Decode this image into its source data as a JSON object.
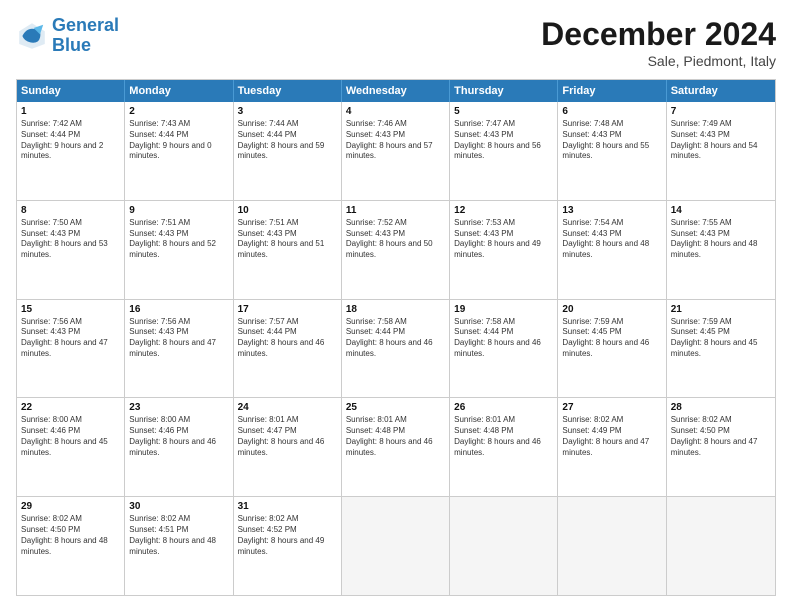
{
  "header": {
    "logo_line1": "General",
    "logo_line2": "Blue",
    "month_title": "December 2024",
    "subtitle": "Sale, Piedmont, Italy"
  },
  "days_of_week": [
    "Sunday",
    "Monday",
    "Tuesday",
    "Wednesday",
    "Thursday",
    "Friday",
    "Saturday"
  ],
  "weeks": [
    [
      {
        "day": "1",
        "sunrise": "7:42 AM",
        "sunset": "4:44 PM",
        "daylight": "9 hours and 2 minutes."
      },
      {
        "day": "2",
        "sunrise": "7:43 AM",
        "sunset": "4:44 PM",
        "daylight": "9 hours and 0 minutes."
      },
      {
        "day": "3",
        "sunrise": "7:44 AM",
        "sunset": "4:44 PM",
        "daylight": "8 hours and 59 minutes."
      },
      {
        "day": "4",
        "sunrise": "7:46 AM",
        "sunset": "4:43 PM",
        "daylight": "8 hours and 57 minutes."
      },
      {
        "day": "5",
        "sunrise": "7:47 AM",
        "sunset": "4:43 PM",
        "daylight": "8 hours and 56 minutes."
      },
      {
        "day": "6",
        "sunrise": "7:48 AM",
        "sunset": "4:43 PM",
        "daylight": "8 hours and 55 minutes."
      },
      {
        "day": "7",
        "sunrise": "7:49 AM",
        "sunset": "4:43 PM",
        "daylight": "8 hours and 54 minutes."
      }
    ],
    [
      {
        "day": "8",
        "sunrise": "7:50 AM",
        "sunset": "4:43 PM",
        "daylight": "8 hours and 53 minutes."
      },
      {
        "day": "9",
        "sunrise": "7:51 AM",
        "sunset": "4:43 PM",
        "daylight": "8 hours and 52 minutes."
      },
      {
        "day": "10",
        "sunrise": "7:51 AM",
        "sunset": "4:43 PM",
        "daylight": "8 hours and 51 minutes."
      },
      {
        "day": "11",
        "sunrise": "7:52 AM",
        "sunset": "4:43 PM",
        "daylight": "8 hours and 50 minutes."
      },
      {
        "day": "12",
        "sunrise": "7:53 AM",
        "sunset": "4:43 PM",
        "daylight": "8 hours and 49 minutes."
      },
      {
        "day": "13",
        "sunrise": "7:54 AM",
        "sunset": "4:43 PM",
        "daylight": "8 hours and 48 minutes."
      },
      {
        "day": "14",
        "sunrise": "7:55 AM",
        "sunset": "4:43 PM",
        "daylight": "8 hours and 48 minutes."
      }
    ],
    [
      {
        "day": "15",
        "sunrise": "7:56 AM",
        "sunset": "4:43 PM",
        "daylight": "8 hours and 47 minutes."
      },
      {
        "day": "16",
        "sunrise": "7:56 AM",
        "sunset": "4:43 PM",
        "daylight": "8 hours and 47 minutes."
      },
      {
        "day": "17",
        "sunrise": "7:57 AM",
        "sunset": "4:44 PM",
        "daylight": "8 hours and 46 minutes."
      },
      {
        "day": "18",
        "sunrise": "7:58 AM",
        "sunset": "4:44 PM",
        "daylight": "8 hours and 46 minutes."
      },
      {
        "day": "19",
        "sunrise": "7:58 AM",
        "sunset": "4:44 PM",
        "daylight": "8 hours and 46 minutes."
      },
      {
        "day": "20",
        "sunrise": "7:59 AM",
        "sunset": "4:45 PM",
        "daylight": "8 hours and 46 minutes."
      },
      {
        "day": "21",
        "sunrise": "7:59 AM",
        "sunset": "4:45 PM",
        "daylight": "8 hours and 45 minutes."
      }
    ],
    [
      {
        "day": "22",
        "sunrise": "8:00 AM",
        "sunset": "4:46 PM",
        "daylight": "8 hours and 45 minutes."
      },
      {
        "day": "23",
        "sunrise": "8:00 AM",
        "sunset": "4:46 PM",
        "daylight": "8 hours and 46 minutes."
      },
      {
        "day": "24",
        "sunrise": "8:01 AM",
        "sunset": "4:47 PM",
        "daylight": "8 hours and 46 minutes."
      },
      {
        "day": "25",
        "sunrise": "8:01 AM",
        "sunset": "4:48 PM",
        "daylight": "8 hours and 46 minutes."
      },
      {
        "day": "26",
        "sunrise": "8:01 AM",
        "sunset": "4:48 PM",
        "daylight": "8 hours and 46 minutes."
      },
      {
        "day": "27",
        "sunrise": "8:02 AM",
        "sunset": "4:49 PM",
        "daylight": "8 hours and 47 minutes."
      },
      {
        "day": "28",
        "sunrise": "8:02 AM",
        "sunset": "4:50 PM",
        "daylight": "8 hours and 47 minutes."
      }
    ],
    [
      {
        "day": "29",
        "sunrise": "8:02 AM",
        "sunset": "4:50 PM",
        "daylight": "8 hours and 48 minutes."
      },
      {
        "day": "30",
        "sunrise": "8:02 AM",
        "sunset": "4:51 PM",
        "daylight": "8 hours and 48 minutes."
      },
      {
        "day": "31",
        "sunrise": "8:02 AM",
        "sunset": "4:52 PM",
        "daylight": "8 hours and 49 minutes."
      },
      null,
      null,
      null,
      null
    ]
  ]
}
